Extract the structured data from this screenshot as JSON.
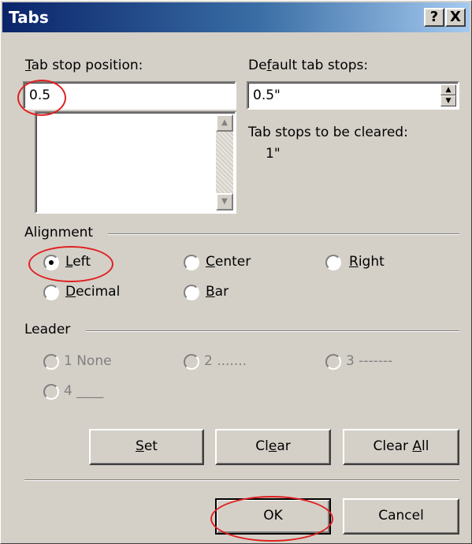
{
  "window": {
    "title": "Tabs",
    "help_button": "?",
    "close_button": "X"
  },
  "tab_stop_position": {
    "label_prefix": "",
    "label_mnemonic": "T",
    "label_rest": "ab stop position:",
    "value": "0.5"
  },
  "default_tab_stops": {
    "label_prefix": "De",
    "label_mnemonic": "f",
    "label_rest": "ault tab stops:",
    "value": "0.5\""
  },
  "tab_stops_to_be_cleared": {
    "label": "Tab stops to be cleared:",
    "value": "1\""
  },
  "alignment": {
    "heading": "Alignment",
    "options": [
      {
        "mnemonic": "L",
        "rest": "eft",
        "selected": true
      },
      {
        "mnemonic": "C",
        "rest": "enter",
        "selected": false
      },
      {
        "mnemonic": "R",
        "rest": "ight",
        "selected": false
      },
      {
        "mnemonic": "D",
        "rest": "ecimal",
        "selected": false
      },
      {
        "mnemonic": "B",
        "rest": "ar",
        "selected": false
      }
    ]
  },
  "leader": {
    "heading": "Leader",
    "options": [
      {
        "label": "1 None"
      },
      {
        "label": "2 ......."
      },
      {
        "label": "3 -------"
      },
      {
        "label": "4 ____"
      }
    ]
  },
  "buttons": {
    "set": {
      "mnemonic": "S",
      "rest": "et"
    },
    "clear": {
      "prefix": "Cl",
      "mnemonic": "e",
      "rest": "ar"
    },
    "clear_all": {
      "prefix": "Clear ",
      "mnemonic": "A",
      "rest": "ll"
    },
    "ok": "OK",
    "cancel": "Cancel"
  },
  "colors": {
    "title_bar_start": "#0a246a",
    "title_bar_end": "#a6caf0",
    "dialog_face": "#d4d0c8",
    "annotation_red": "#e02020"
  }
}
